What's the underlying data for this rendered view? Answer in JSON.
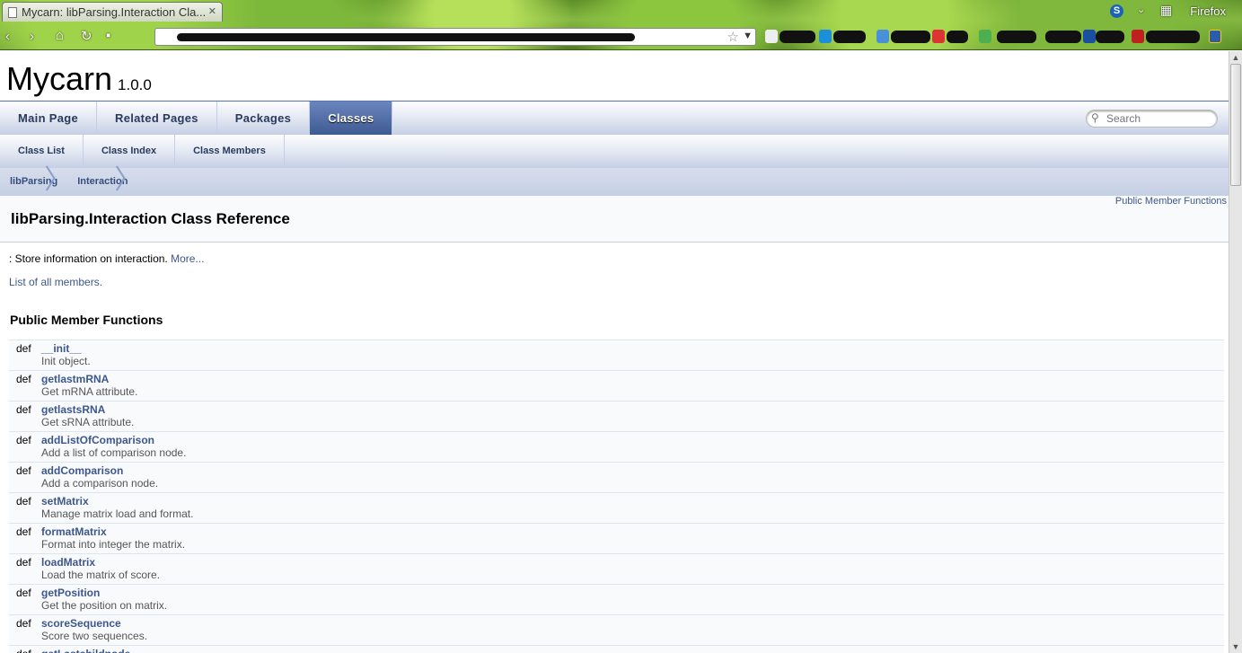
{
  "browser": {
    "tab_title": "Mycarn: libParsing.Interaction Cla...",
    "app_label": "Firefox",
    "skype_badge": "S"
  },
  "project": {
    "name": "Mycarn",
    "number": "1.0.0"
  },
  "nav_main": [
    "Main Page",
    "Related Pages",
    "Packages",
    "Classes"
  ],
  "nav_sub": [
    "Class List",
    "Class Index",
    "Class Members"
  ],
  "search": {
    "placeholder": "Search"
  },
  "breadcrumb": [
    "libParsing",
    "Interaction"
  ],
  "header": {
    "summary_link": "Public Member Functions",
    "title": "libParsing.Interaction Class Reference"
  },
  "brief": {
    "text": ": Store information on interaction. ",
    "more": "More..."
  },
  "all_members_link": "List of all members.",
  "section_heading": "Public Member Functions",
  "members": [
    {
      "kw": "def",
      "name": "__init__",
      "desc": "Init object."
    },
    {
      "kw": "def",
      "name": "getlastmRNA",
      "desc": "Get mRNA attribute."
    },
    {
      "kw": "def",
      "name": "getlastsRNA",
      "desc": "Get sRNA attribute."
    },
    {
      "kw": "def",
      "name": "addListOfComparison",
      "desc": "Add a list of comparison node."
    },
    {
      "kw": "def",
      "name": "addComparison",
      "desc": "Add a comparison node."
    },
    {
      "kw": "def",
      "name": "setMatrix",
      "desc": "Manage matrix load and format."
    },
    {
      "kw": "def",
      "name": "formatMatrix",
      "desc": "Format into integer the matrix."
    },
    {
      "kw": "def",
      "name": "loadMatrix",
      "desc": "Load the matrix of score."
    },
    {
      "kw": "def",
      "name": "getPosition",
      "desc": "Get the position on matrix."
    },
    {
      "kw": "def",
      "name": "scoreSequence",
      "desc": "Score two sequences."
    },
    {
      "kw": "def",
      "name": "getLastchildnode",
      "desc": ""
    }
  ]
}
